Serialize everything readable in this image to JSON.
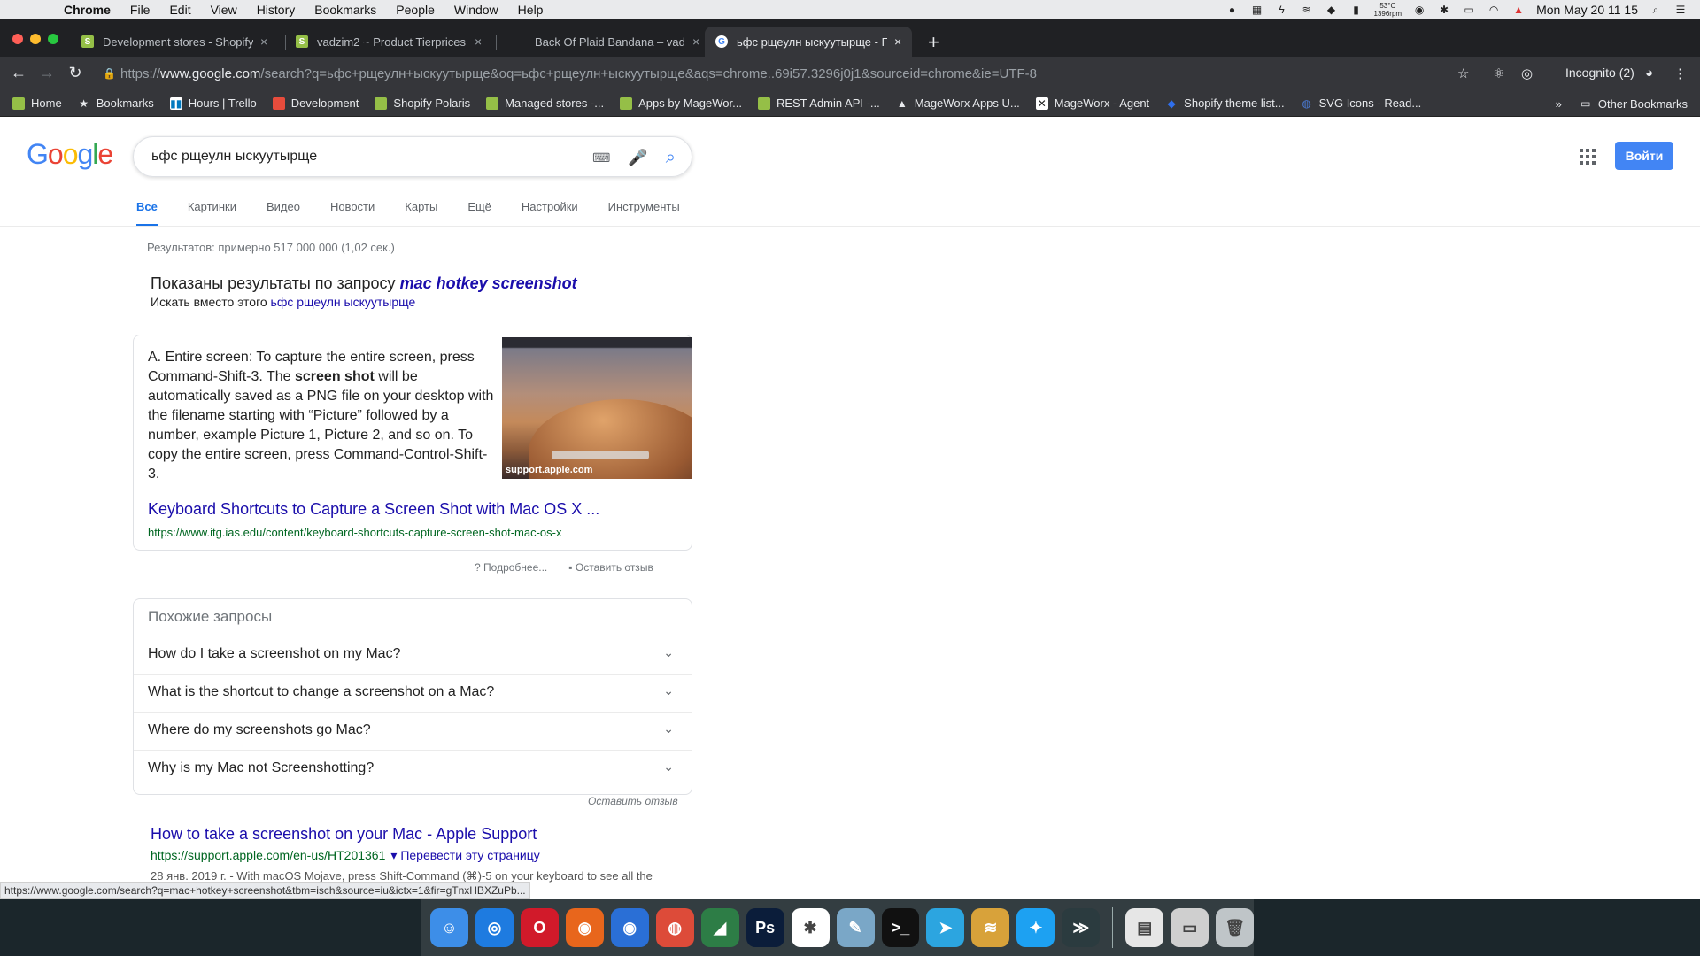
{
  "menubar": {
    "app": "Chrome",
    "items": [
      "File",
      "Edit",
      "View",
      "History",
      "Bookmarks",
      "People",
      "Window",
      "Help"
    ],
    "temp_line1": "53°C",
    "temp_line2": "1396rpm",
    "datetime": "Mon May 20  11 15"
  },
  "tabs": [
    {
      "label": "Development stores - Shopify",
      "favicon_color": "#95bf47"
    },
    {
      "label": "vadzim2 ~ Product Tierprices",
      "favicon_color": "#95bf47"
    },
    {
      "label": "Back Of Plaid Bandana – vadzim",
      "favicon_color": "none"
    },
    {
      "label": "ьфс рщеулн ыскуутырще - По",
      "favicon_color": "#4285f4",
      "active": true
    }
  ],
  "toolbar": {
    "url_scheme": "https://",
    "url_host": "www.google.com",
    "url_path": "/search?q=ьфс+рщеулн+ыскуутырще&oq=ьфс+рщеулн+ыскуутырще&aqs=chrome..69i57.3296j0j1&sourceid=chrome&ie=UTF-8",
    "incognito": "Incognito (2)"
  },
  "bookmarks": [
    {
      "label": "Home",
      "icon": "shopify-icon"
    },
    {
      "label": "Bookmarks",
      "icon": "star-icon"
    },
    {
      "label": "Hours | Trello",
      "icon": "trello-icon"
    },
    {
      "label": "Development",
      "icon": "dev-icon"
    },
    {
      "label": "Shopify Polaris",
      "icon": "shopify-icon"
    },
    {
      "label": "Managed stores -...",
      "icon": "shopify-icon"
    },
    {
      "label": "Apps by MageWor...",
      "icon": "shopify-icon"
    },
    {
      "label": "REST Admin API -...",
      "icon": "shopify-icon"
    },
    {
      "label": "MageWorx Apps U...",
      "icon": "mortarboard-icon"
    },
    {
      "label": "MageWorx - Agent",
      "icon": "x-icon"
    },
    {
      "label": "Shopify theme list...",
      "icon": "dropbox-icon"
    },
    {
      "label": "SVG Icons - Read...",
      "icon": "globe-icon"
    }
  ],
  "bookmarks_overflow": "»",
  "other_bookmarks": "Other Bookmarks",
  "google": {
    "logo": "Google",
    "query": "ьфс рщеулн ыскуутырще",
    "signin": "Войти",
    "tabs": [
      "Все",
      "Картинки",
      "Видео",
      "Новости",
      "Карты",
      "Ещё",
      "Настройки",
      "Инструменты"
    ],
    "stats": "Результатов: примерно 517 000 000 (1,02 сек.)",
    "showing_prefix": "Показаны результаты по запросу ",
    "showing_query": "mac hotkey screenshot",
    "instead_prefix": "Искать вместо этого ",
    "instead_query": "ьфс рщеулн ыскуутырще",
    "snippet": {
      "text_1": "A. Entire screen: To capture the entire screen, press Command-Shift-3. The ",
      "text_bold": "screen shot",
      "text_2": " will be automatically saved as a PNG file on your desktop with the filename starting with “Picture” followed by a number, example Picture 1, Picture 2, and so on. To copy the entire screen, press Command-Control-Shift-3.",
      "image_source": "support.apple.com",
      "title": "Keyboard Shortcuts to Capture a Screen Shot with Mac OS X ...",
      "url": "https://www.itg.ias.edu/content/keyboard-shortcuts-capture-screen-shot-mac-os-x",
      "more": "Подробнее...",
      "feedback": "Оставить отзыв"
    },
    "paa": {
      "heading": "Похожие запросы",
      "questions": [
        "How do I take a screenshot on my Mac?",
        "What is the shortcut to change a screenshot on a Mac?",
        "Where do my screenshots go Mac?",
        "Why is my Mac not Screenshotting?"
      ],
      "feedback": "Оставить отзыв"
    },
    "result": {
      "title": "How to take a screenshot on your Mac - Apple Support",
      "url": "https://support.apple.com/en-us/HT201361",
      "translate": "Перевести эту страницу",
      "desc": "28 янв. 2019 г. - With macOS Mojave, press Shift-Command (⌘)-5 on your keyboard to see all the"
    }
  },
  "statusbar": "https://www.google.com/search?q=mac+hotkey+screenshot&tbm=isch&source=iu&ictx=1&fir=gTnxHBXZuPb...",
  "dock": [
    {
      "name": "finder",
      "color": "#3d8ee8",
      "glyph": "☺"
    },
    {
      "name": "safari",
      "color": "#1e7be0",
      "glyph": "◎"
    },
    {
      "name": "opera",
      "color": "#d11a2a",
      "glyph": "O"
    },
    {
      "name": "firefox",
      "color": "#e8661c",
      "glyph": "◉"
    },
    {
      "name": "firefox-dev",
      "color": "#2a6fd6",
      "glyph": "◉"
    },
    {
      "name": "chrome",
      "color": "#dd4b39",
      "glyph": "◍"
    },
    {
      "name": "visual-studio",
      "color": "#2d7d46",
      "glyph": "◢"
    },
    {
      "name": "photoshop",
      "color": "#0b1d3a",
      "glyph": "Ps"
    },
    {
      "name": "slack",
      "color": "#ffffff",
      "glyph": "✱"
    },
    {
      "name": "preview",
      "color": "#7aa7c7",
      "glyph": "✎"
    },
    {
      "name": "terminal",
      "color": "#111111",
      "glyph": ">_"
    },
    {
      "name": "telegram",
      "color": "#2ca5e0",
      "glyph": "➤"
    },
    {
      "name": "sequel",
      "color": "#d8a23a",
      "glyph": "≋"
    },
    {
      "name": "twitter",
      "color": "#1da1f2",
      "glyph": "✦"
    },
    {
      "name": "sublime",
      "color": "#2b3b3f",
      "glyph": "≫"
    },
    {
      "name": "file",
      "color": "#e6e6e6",
      "glyph": "▤"
    },
    {
      "name": "drive",
      "color": "#cfcfcf",
      "glyph": "▭"
    },
    {
      "name": "trash",
      "color": "#bfc5c8",
      "glyph": "🗑"
    }
  ]
}
